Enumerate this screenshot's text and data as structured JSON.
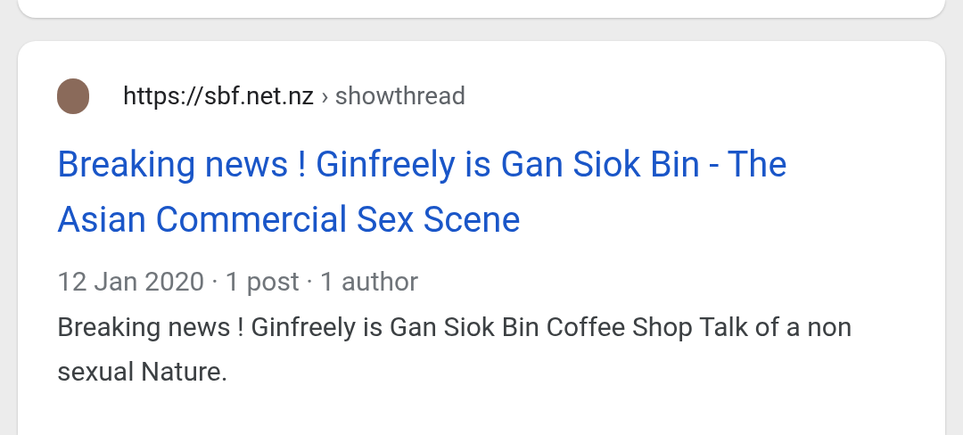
{
  "result": {
    "url": "https://sbf.net.nz",
    "breadcrumb": "› showthread",
    "title": "Breaking news ! Ginfreely is Gan Siok Bin - The Asian Commercial Sex Scene",
    "meta": "12 Jan 2020 · 1 post · 1 author",
    "snippet": "Breaking news ! Ginfreely is Gan Siok Bin Coffee Shop Talk of a non sexual Nature."
  }
}
